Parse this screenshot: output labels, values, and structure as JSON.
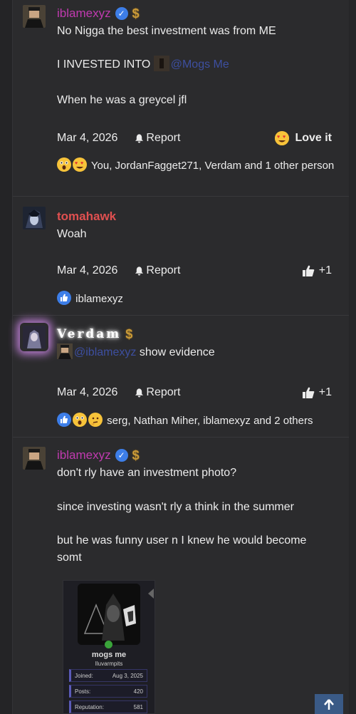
{
  "posts": [
    {
      "username": "iblamexyz",
      "lines": [
        "No Nigga the best investment was from ME",
        "I INVESTED INTO",
        "When he was a greycel jfl"
      ],
      "mention": "@Mogs Me",
      "date": "Mar 4, 2026",
      "report": "Report",
      "reaction_label": "Love it",
      "reactions_text": "You, JordanFagget271, Verdam and 1 other person"
    },
    {
      "username": "tomahawk",
      "lines": [
        "Woah"
      ],
      "date": "Mar 4, 2026",
      "report": "Report",
      "reaction_label": "+1",
      "reactions_text": "iblamexyz"
    },
    {
      "username": "Verdam",
      "mention": "@iblamexyz",
      "lines": [
        "show evidence"
      ],
      "date": "Mar 4, 2026",
      "report": "Report",
      "reaction_label": "+1",
      "reactions_text": "serg, Nathan Miher, iblamexyz and 2 others"
    },
    {
      "username": "iblamexyz",
      "lines": [
        "don't rly have an investment photo?",
        "since investing wasn't rly a think in the summer",
        "but he was funny user n I knew he would become somt"
      ]
    }
  ],
  "card": {
    "name": "mogs me",
    "subtitle": "Iluvarmpits",
    "rows": [
      {
        "label": "Joined:",
        "value": "Aug 3, 2025"
      },
      {
        "label": "Posts:",
        "value": "420"
      },
      {
        "label": "Reputation:",
        "value": "581"
      }
    ]
  },
  "icons": {
    "verified": "verified-badge-icon",
    "dollar": "$",
    "bell": "bell-icon",
    "thumb": "thumbs-up-icon",
    "scroll": "arrow-up-icon"
  }
}
